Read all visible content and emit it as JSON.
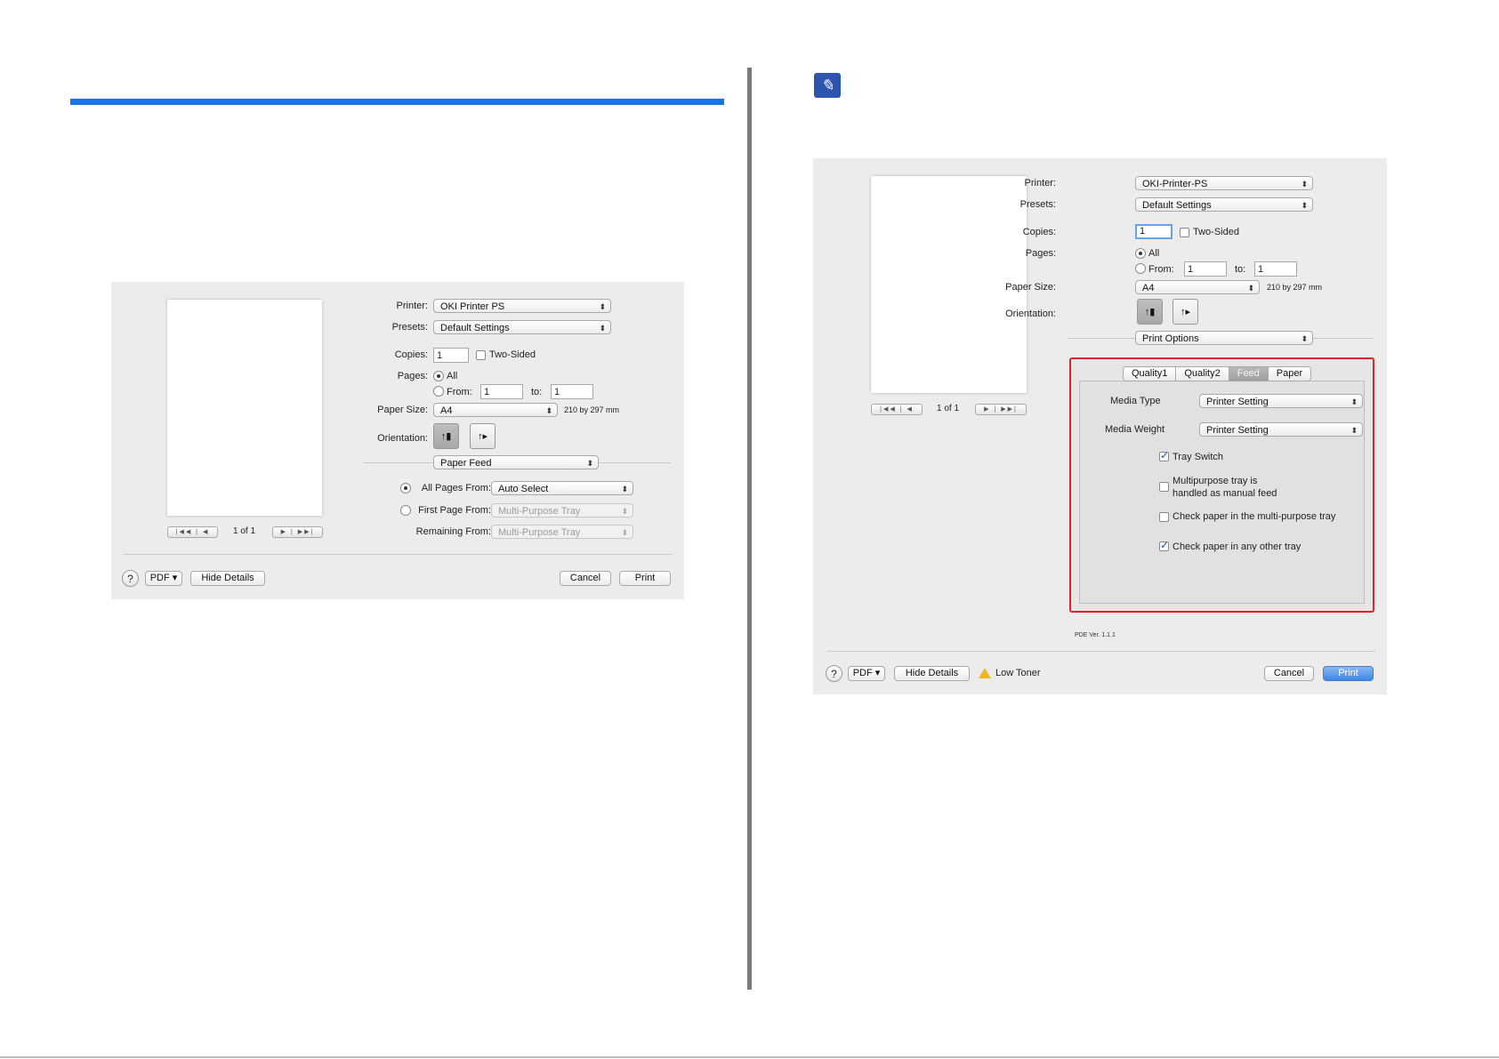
{
  "left_dialog": {
    "printer_label": "Printer:",
    "printer_value": "OKI Printer PS",
    "presets_label": "Presets:",
    "presets_value": "Default Settings",
    "copies_label": "Copies:",
    "copies_value": "1",
    "two_sided_label": "Two-Sided",
    "two_sided_checked": false,
    "pages_label": "Pages:",
    "pages_all_label": "All",
    "pages_from_label": "From:",
    "pages_from_value": "1",
    "pages_to_label": "to:",
    "pages_to_value": "1",
    "paper_size_label": "Paper Size:",
    "paper_size_value": "A4",
    "paper_size_dims": "210 by 297 mm",
    "orientation_label": "Orientation:",
    "section_popup": "Paper Feed",
    "all_pages_from_label": "All Pages From:",
    "all_pages_from_value": "Auto Select",
    "first_page_from_label": "First Page From:",
    "first_page_from_value": "Multi-Purpose Tray",
    "remaining_from_label": "Remaining From:",
    "remaining_from_value": "Multi-Purpose Tray",
    "page_counter": "1 of 1",
    "help_label": "?",
    "pdf_label": "PDF ▾",
    "hide_details_label": "Hide Details",
    "cancel_label": "Cancel",
    "print_label": "Print"
  },
  "right_dialog": {
    "printer_label": "Printer:",
    "printer_value": "OKI-Printer-PS",
    "presets_label": "Presets:",
    "presets_value": "Default Settings",
    "copies_label": "Copies:",
    "copies_value": "1",
    "two_sided_label": "Two-Sided",
    "two_sided_checked": false,
    "pages_label": "Pages:",
    "pages_all_label": "All",
    "pages_from_label": "From:",
    "pages_from_value": "1",
    "pages_to_label": "to:",
    "pages_to_value": "1",
    "paper_size_label": "Paper Size:",
    "paper_size_value": "A4",
    "paper_size_dims": "210 by 297 mm",
    "orientation_label": "Orientation:",
    "section_popup": "Print Options",
    "tabs": [
      "Quality1",
      "Quality2",
      "Feed",
      "Paper"
    ],
    "selected_tab": "Feed",
    "media_type_label": "Media Type",
    "media_type_value": "Printer Setting",
    "media_weight_label": "Media Weight",
    "media_weight_value": "Printer Setting",
    "tray_switch_label": "Tray Switch",
    "tray_switch_checked": true,
    "multipurpose_manual_label_line1": "Multipurpose tray is",
    "multipurpose_manual_label_line2": "handled as manual feed",
    "multipurpose_manual_checked": false,
    "check_mp_label": "Check paper in the multi-purpose tray",
    "check_mp_checked": false,
    "check_other_label": "Check paper in any other tray",
    "check_other_checked": true,
    "pde_version": "PDE Ver. 1.1.1",
    "page_counter": "1 of 1",
    "help_label": "?",
    "pdf_label": "PDF ▾",
    "hide_details_label": "Hide Details",
    "low_toner_label": "Low Toner",
    "cancel_label": "Cancel",
    "print_label": "Print"
  },
  "icons": {
    "note_icon": "pencil-note-icon",
    "warning_icon": "warning-triangle-icon"
  },
  "colors": {
    "accent_rule": "#1a73e8",
    "highlight_border": "#e0202b",
    "note_icon_bg": "#2d55b0"
  }
}
